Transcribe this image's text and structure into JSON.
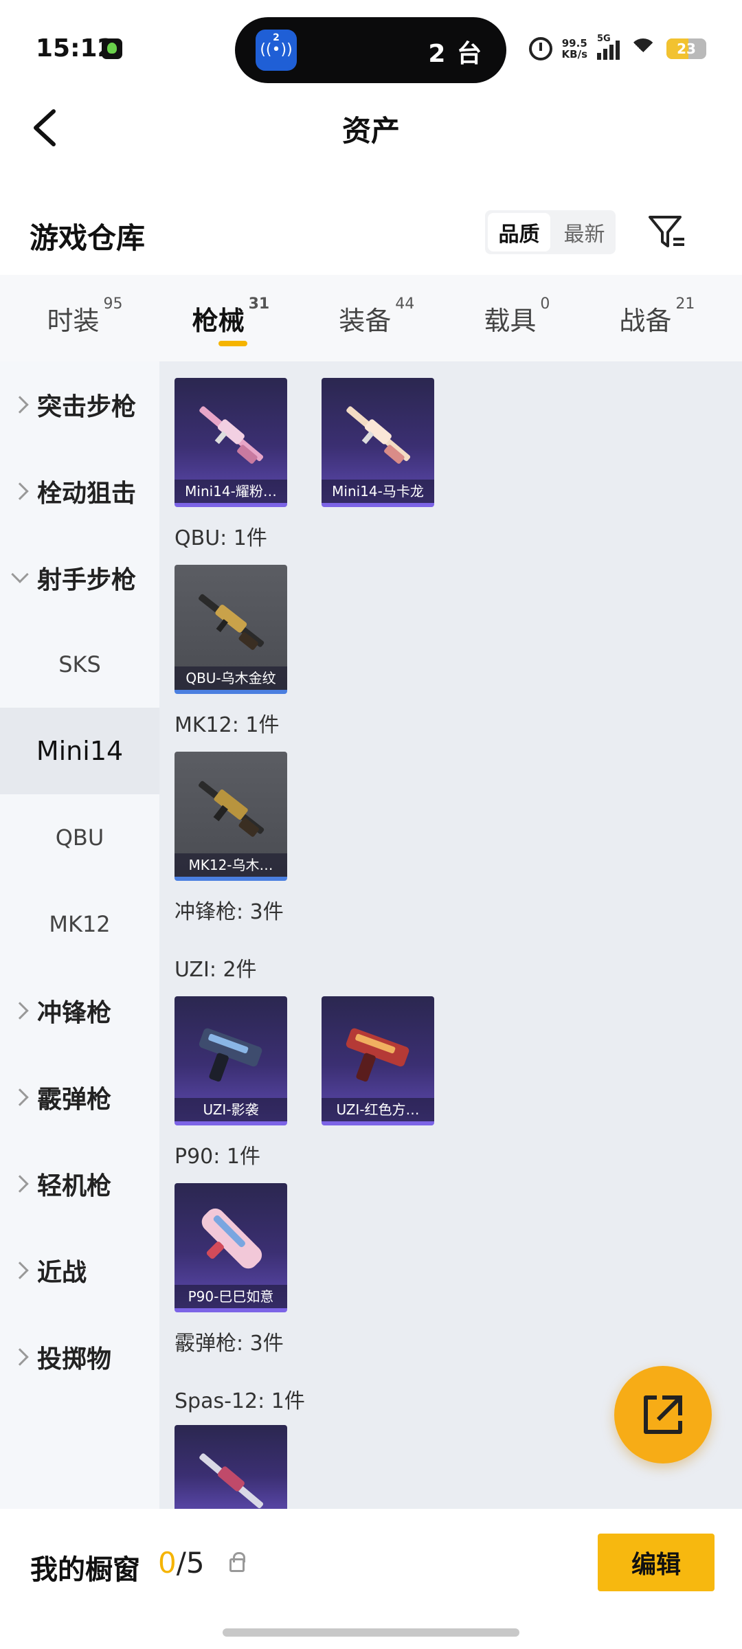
{
  "status_bar": {
    "time": "15:12",
    "island_badge_number": "2",
    "island_text": "2 台",
    "net_speed_value": "99.5",
    "net_speed_unit": "KB/s",
    "signal_label": "5G",
    "battery_level": "23"
  },
  "header": {
    "title": "资产"
  },
  "warehouse": {
    "title": "游戏仓库",
    "sort_options": [
      "品质",
      "最新"
    ],
    "sort_selected": "品质"
  },
  "tabs": [
    {
      "label": "时装",
      "count": "95"
    },
    {
      "label": "枪械",
      "count": "31",
      "active": true
    },
    {
      "label": "装备",
      "count": "44"
    },
    {
      "label": "载具",
      "count": "0"
    },
    {
      "label": "战备",
      "count": "21"
    }
  ],
  "sidebar": [
    {
      "label": "突击步枪",
      "type": "parent"
    },
    {
      "label": "栓动狙击",
      "type": "parent"
    },
    {
      "label": "射手步枪",
      "type": "parent",
      "expanded": true
    },
    {
      "label": "SKS",
      "type": "sub"
    },
    {
      "label": "Mini14",
      "type": "sub",
      "selected": true
    },
    {
      "label": "QBU",
      "type": "sub"
    },
    {
      "label": "MK12",
      "type": "sub"
    },
    {
      "label": "冲锋枪",
      "type": "parent"
    },
    {
      "label": "霰弹枪",
      "type": "parent"
    },
    {
      "label": "轻机枪",
      "type": "parent"
    },
    {
      "label": "近战",
      "type": "parent"
    },
    {
      "label": "投掷物",
      "type": "parent"
    }
  ],
  "content": {
    "items": [
      {
        "name": "Mini14-耀粉…",
        "style": "purple"
      },
      {
        "name": "Mini14-马卡龙",
        "style": "purple"
      },
      {
        "name": "QBU-乌木金纹",
        "style": "grey"
      },
      {
        "name": "MK12-乌木…",
        "style": "grey"
      },
      {
        "name": "UZI-影袭",
        "style": "purple"
      },
      {
        "name": "UZI-红色方…",
        "style": "purple"
      },
      {
        "name": "P90-巳巳如意",
        "style": "purple"
      }
    ],
    "group_labels": [
      "QBU: 1件",
      "MK12: 1件",
      "冲锋枪: 3件",
      "UZI: 2件",
      "P90: 1件",
      "霰弹枪: 3件",
      "Spas-12: 1件"
    ]
  },
  "bottom_bar": {
    "title": "我的橱窗",
    "count_current": "0",
    "count_total": "/5",
    "edit_label": "编辑"
  },
  "colors": {
    "accent": "#f5b400",
    "card_purple": "#3b2f72",
    "card_grey": "#4a4c52"
  }
}
